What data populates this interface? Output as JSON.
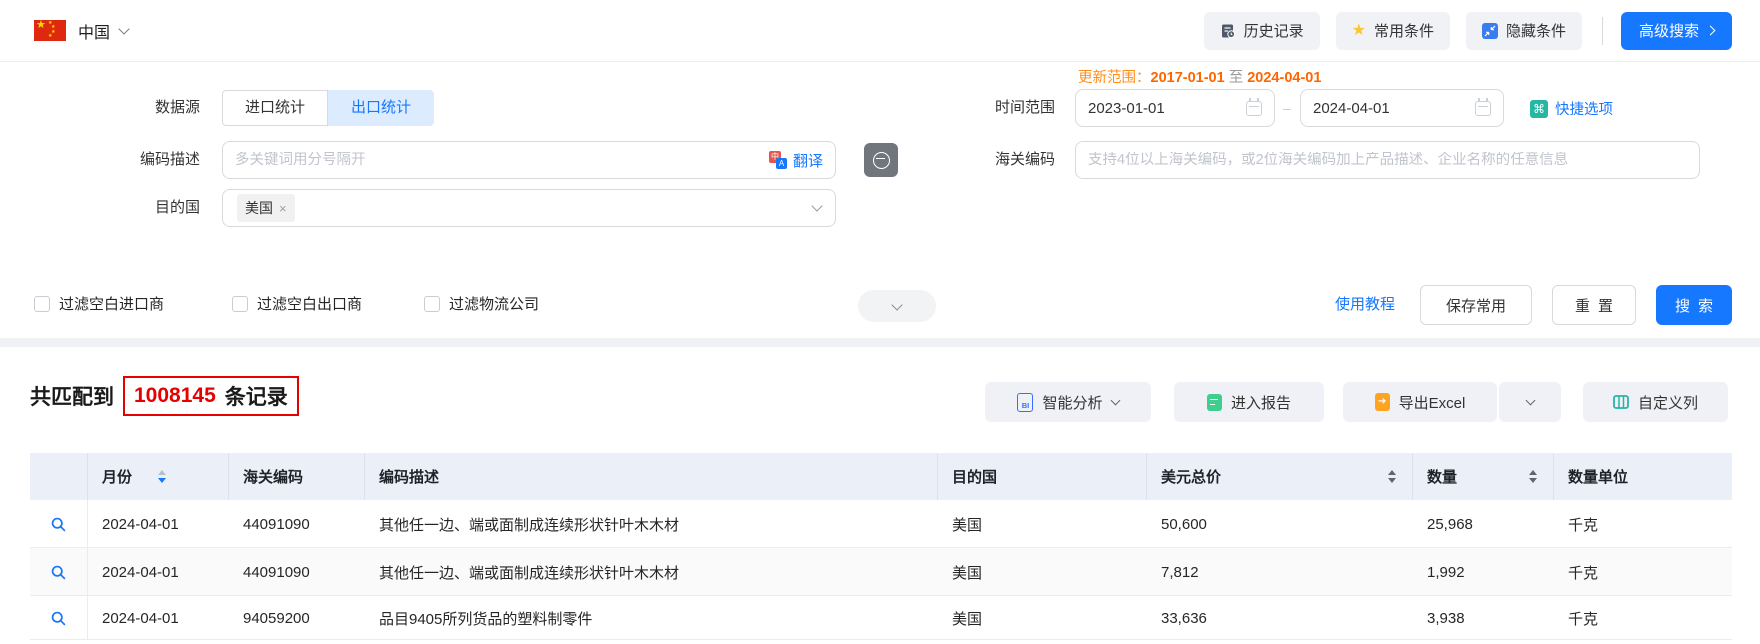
{
  "topbar": {
    "country": "中国",
    "buttons": {
      "history": "历史记录",
      "favorites": "常用条件",
      "hide": "隐藏条件",
      "advanced": "高级搜索"
    }
  },
  "form": {
    "update_range": {
      "label": "更新范围：",
      "from": "2017-01-01",
      "to_word": "至",
      "to": "2024-04-01"
    },
    "data_source": {
      "label": "数据源",
      "import_tab": "进口统计",
      "export_tab": "出口统计"
    },
    "time_range": {
      "label": "时间范围",
      "from": "2023-01-01",
      "separator": "–",
      "to": "2024-04-01",
      "quick_label": "快捷选项",
      "quick_icon": "⌘"
    },
    "code_desc": {
      "label": "编码描述",
      "placeholder": "多关键词用分号隔开",
      "translate_label": "翻译",
      "translate_icon_cn": "中",
      "translate_icon_en": "A"
    },
    "hs_code": {
      "label": "海关编码",
      "placeholder": "支持4位以上海关编码，或2位海关编码加上产品描述、企业名称的任意信息"
    },
    "destination": {
      "label": "目的国",
      "tag": "美国",
      "remove": "×"
    },
    "filters": {
      "f1": "过滤空白进口商",
      "f2": "过滤空白出口商",
      "f3": "过滤物流公司"
    },
    "links": {
      "tutorial": "使用教程"
    },
    "buttons": {
      "save": "保存常用",
      "reset": "重置",
      "search": "搜索"
    }
  },
  "results": {
    "match_prefix": "共匹配到",
    "match_count": "1008145",
    "match_suffix": "条记录",
    "actions": {
      "analysis": "智能分析",
      "analysis_icon": "BI",
      "report": "进入报告",
      "export": "导出Excel",
      "custom": "自定义列",
      "excel_arrow": "➔"
    }
  },
  "table": {
    "headers": {
      "month": "月份",
      "hs_code": "海关编码",
      "desc": "编码描述",
      "dest": "目的国",
      "usd": "美元总价",
      "qty": "数量",
      "unit": "数量单位"
    },
    "rows": [
      {
        "month": "2024-04-01",
        "hs_code": "44091090",
        "desc": "其他任一边、端或面制成连续形状针叶木木材",
        "dest": "美国",
        "usd": "50,600",
        "qty": "25,968",
        "unit": "千克"
      },
      {
        "month": "2024-04-01",
        "hs_code": "44091090",
        "desc": "其他任一边、端或面制成连续形状针叶木木材",
        "dest": "美国",
        "usd": "7,812",
        "qty": "1,992",
        "unit": "千克"
      },
      {
        "month": "2024-04-01",
        "hs_code": "94059200",
        "desc": "品目9405所列货品的塑料制零件",
        "dest": "美国",
        "usd": "33,636",
        "qty": "3,938",
        "unit": "千克"
      }
    ]
  },
  "colors": {
    "accent": "#1677ff",
    "update_orange": "#ff6600",
    "count_red": "#e60000",
    "star_yellow": "#fcc630",
    "quick_teal": "#26b7a4"
  }
}
